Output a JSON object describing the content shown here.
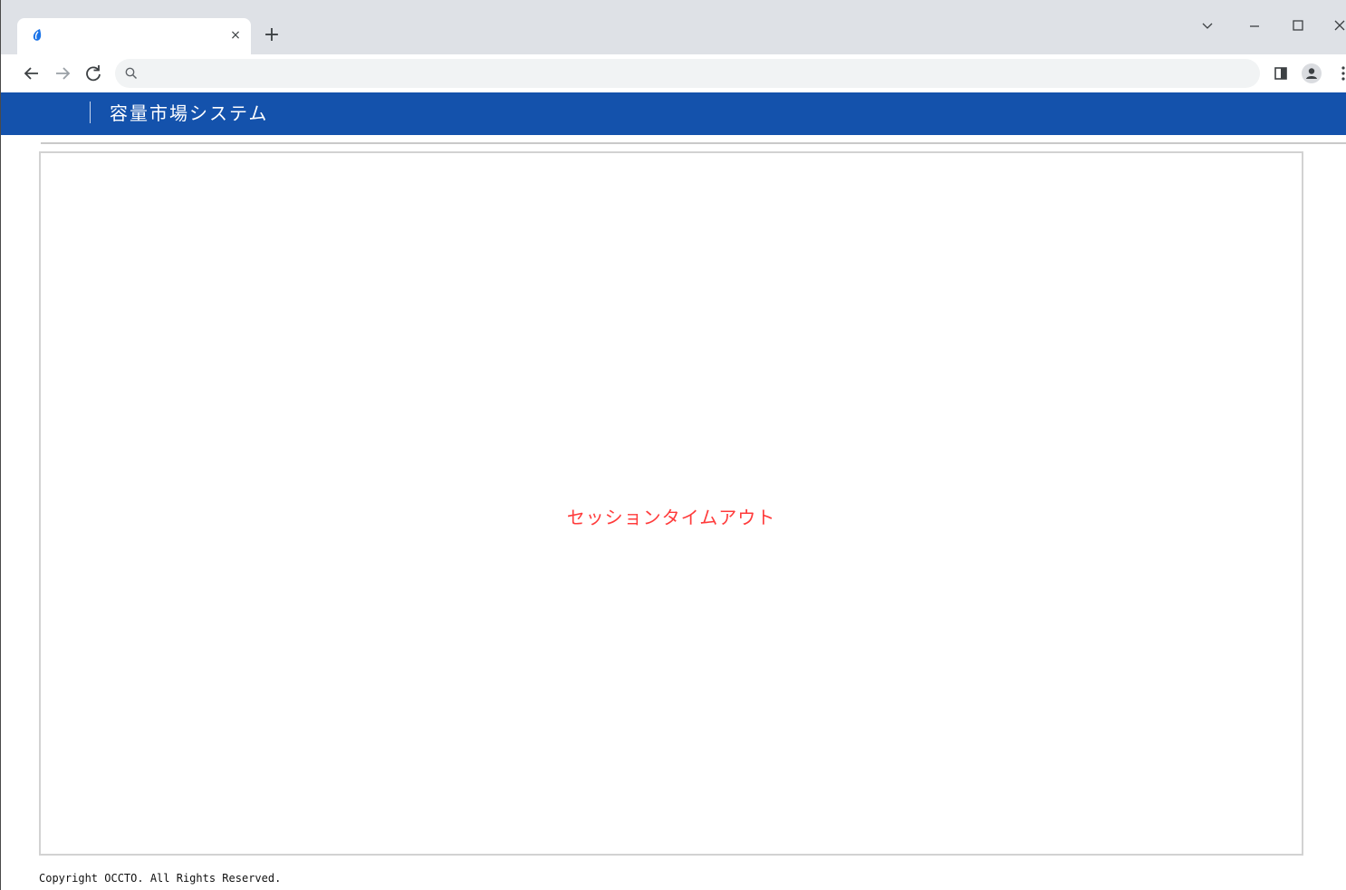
{
  "browser": {
    "tab": {
      "title": "",
      "favicon": "droplet-icon",
      "close_label": "×"
    },
    "new_tab_label": "+",
    "window_controls": {
      "tab_search": "⌵",
      "minimize": "–",
      "maximize": "☐",
      "close": "✕"
    },
    "nav": {
      "back": "←",
      "forward": "→",
      "reload": "C"
    },
    "omnibox": {
      "value": "",
      "placeholder": ""
    }
  },
  "app": {
    "header_color": "#1452ac",
    "title": "容量市場システム"
  },
  "main": {
    "message": "セッションタイムアウト",
    "message_color": "#ff3b3b"
  },
  "footer": {
    "copyright": "Copyright OCCTO. All Rights Reserved."
  }
}
